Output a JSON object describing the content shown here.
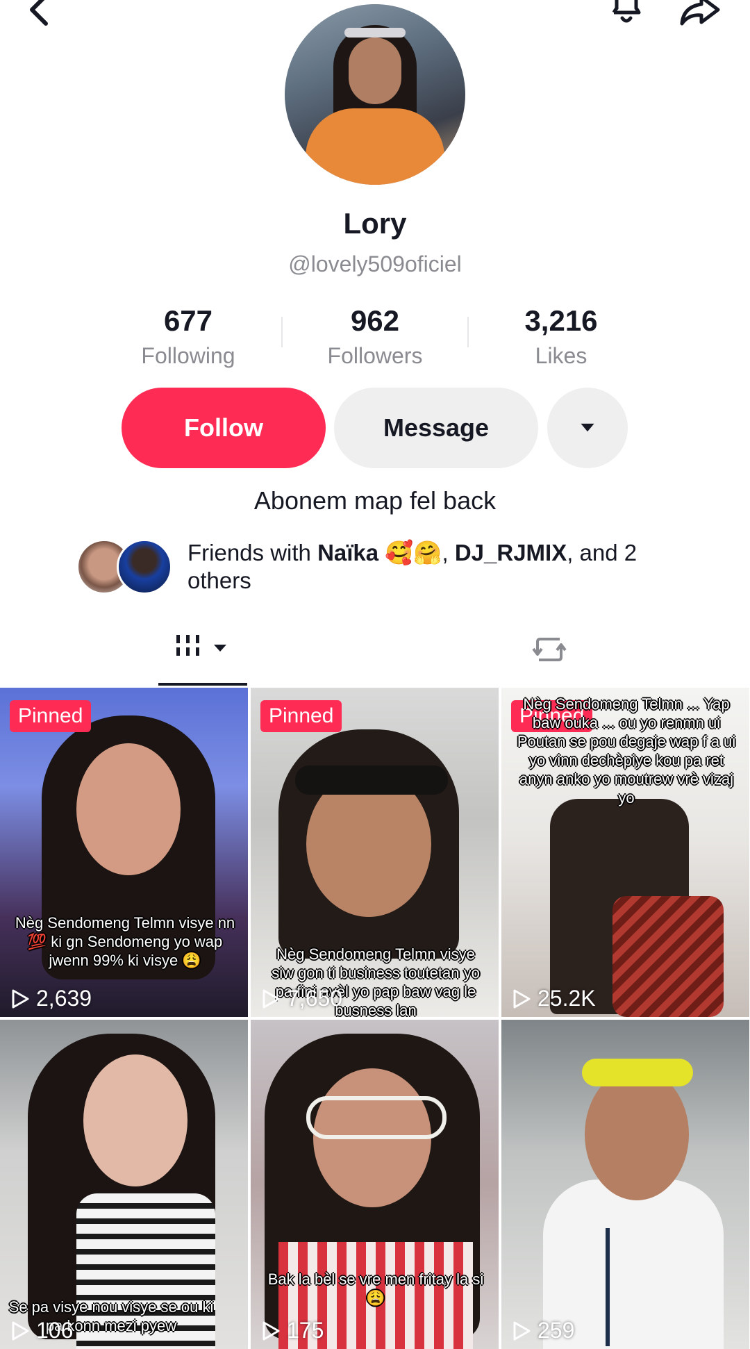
{
  "profile": {
    "name": "Lory",
    "handle": "@lovely509oficiel",
    "bio": "Abonem map fel back"
  },
  "stats": [
    {
      "value": "677",
      "label": "Following"
    },
    {
      "value": "962",
      "label": "Followers"
    },
    {
      "value": "3,216",
      "label": "Likes"
    }
  ],
  "actions": {
    "follow_label": "Follow",
    "message_label": "Message"
  },
  "friends": {
    "prefix": "Friends with ",
    "name1": "Naïka",
    "emoji1": "🥰🤗",
    "sep": ", ",
    "name2": "DJ_RJMIX",
    "suffix": ", and 2 others"
  },
  "colors": {
    "accent": "#fe2c55",
    "secondary_button": "#efefef",
    "muted_text": "#8a8b91"
  },
  "videos": [
    {
      "pinned": "Pinned",
      "views": "2,639",
      "caption": "Nèg Sendomeng Telmn visye nn 💯 ki gn Sendomeng yo wap jwenn 99% ki visye 😩"
    },
    {
      "pinned": "Pinned",
      "views": "7,650",
      "caption": "Nèg Sendomeng Telmn visye siw gon ti business toutetan yo pa fini avèl yo pap baw vag le busness lan"
    },
    {
      "pinned": "Pinned",
      "views": "25.2K",
      "caption": "Nèg Sendomeng Telmn ... Yap baw ouka ... ou yo renmn ui Poutan se pou degaje wap f a ui yo vinn dechèpiye kou pa ret anyn anko yo moutrew vrè vizaj yo"
    },
    {
      "pinned": "",
      "views": "106",
      "caption": "Se pa visye nou visye se ou ki pa konn mezi pyew"
    },
    {
      "pinned": "",
      "views": "175",
      "caption": "Bak la bèl se vre men fritay la si 😩"
    },
    {
      "pinned": "",
      "views": "259",
      "caption": ""
    }
  ],
  "icons": [
    "back-icon",
    "bell-icon",
    "share-icon",
    "chevron-down-icon",
    "grid-videos-icon",
    "repost-icon",
    "play-icon"
  ]
}
